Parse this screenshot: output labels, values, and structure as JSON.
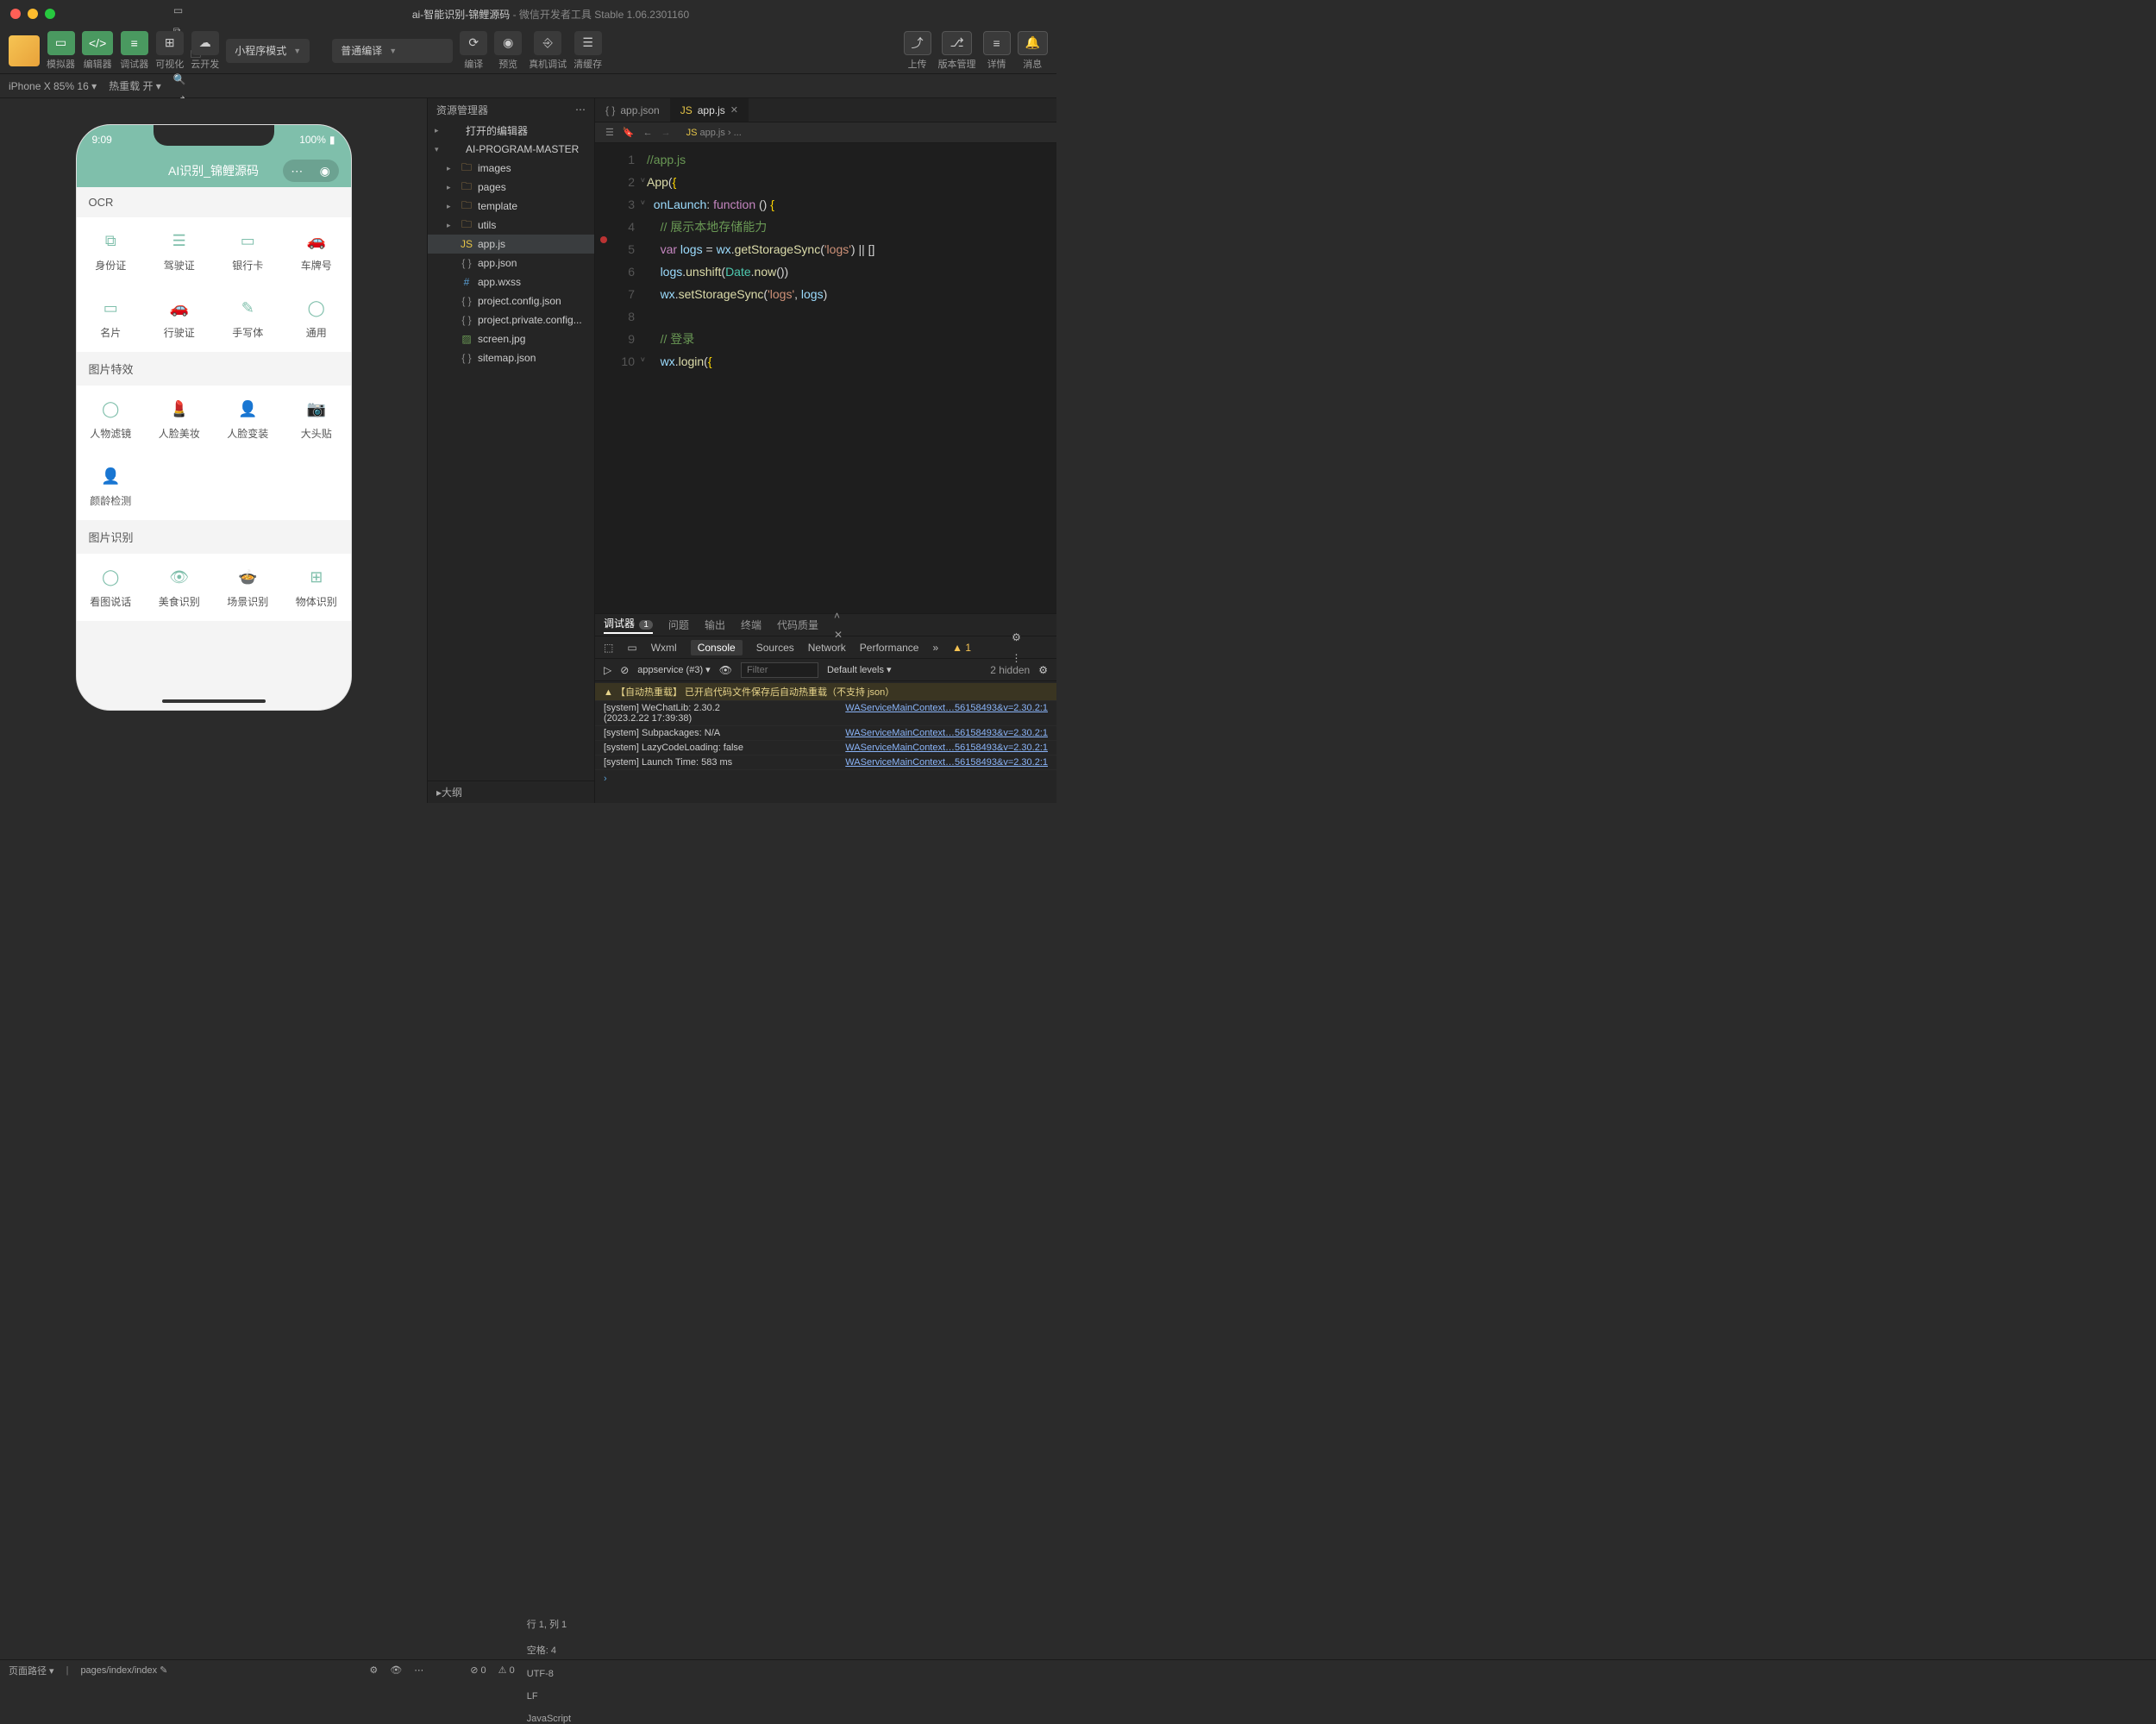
{
  "titlebar": {
    "project": "ai-智能识别-锦鲤源码",
    "app": "微信开发者工具 Stable 1.06.2301160"
  },
  "toolbar": {
    "simulator": "模拟器",
    "editor": "编辑器",
    "debugger": "调试器",
    "visual": "可视化",
    "cloud": "云开发",
    "mode": "小程序模式",
    "compile": "普通编译",
    "compile_btn": "编译",
    "preview": "预览",
    "remote": "真机调试",
    "clear": "清缓存",
    "upload": "上传",
    "version": "版本管理",
    "detail": "详情",
    "message": "消息"
  },
  "statusrow": {
    "device": "iPhone X 85% 16",
    "hotreload": "热重载 开"
  },
  "phone": {
    "time": "9:09",
    "battery": "100%",
    "title": "AI识别_锦鲤源码",
    "sections": [
      {
        "header": "OCR",
        "items": [
          "身份证",
          "驾驶证",
          "银行卡",
          "车牌号",
          "名片",
          "行驶证",
          "手写体",
          "通用"
        ]
      },
      {
        "header": "图片特效",
        "items": [
          "人物滤镜",
          "人脸美妆",
          "人脸变装",
          "大头贴",
          "颜龄检测"
        ]
      },
      {
        "header": "图片识别",
        "items": [
          "看图说话",
          "美食识别",
          "场景识别",
          "物体识别"
        ]
      }
    ]
  },
  "explorer": {
    "title": "资源管理器",
    "open_editors": "打开的编辑器",
    "root": "AI-PROGRAM-MASTER",
    "folders": [
      "images",
      "pages",
      "template",
      "utils"
    ],
    "files": [
      {
        "name": "app.js",
        "type": "js",
        "sel": true
      },
      {
        "name": "app.json",
        "type": "json"
      },
      {
        "name": "app.wxss",
        "type": "wxss"
      },
      {
        "name": "project.config.json",
        "type": "json"
      },
      {
        "name": "project.private.config...",
        "type": "json"
      },
      {
        "name": "screen.jpg",
        "type": "img"
      },
      {
        "name": "sitemap.json",
        "type": "json"
      }
    ],
    "outline": "大纲"
  },
  "editor": {
    "tabs": [
      {
        "name": "app.json",
        "icon": "json",
        "active": false
      },
      {
        "name": "app.js",
        "icon": "js",
        "active": true
      }
    ],
    "breadcrumb": "app.js › ...",
    "lines": [
      {
        "n": 1,
        "html": "<span class='c-comment'>//app.js</span>"
      },
      {
        "n": 2,
        "fold": "down",
        "html": "<span class='c-call'>App</span><span class='c-pun'>(</span><span class='c-brace'>{</span>"
      },
      {
        "n": 3,
        "fold": "down",
        "html": "  <span class='c-var'>onLaunch</span><span class='c-pun'>: </span><span class='c-kw'>function</span> <span class='c-pun'>() </span><span class='c-brace'>{</span>"
      },
      {
        "n": 4,
        "html": "    <span class='c-comment'>// 展示本地存储能力</span>"
      },
      {
        "n": 5,
        "bp": true,
        "html": "    <span class='c-kw'>var</span> <span class='c-var'>logs</span> <span class='c-pun'>=</span> <span class='c-var'>wx</span><span class='c-pun'>.</span><span class='c-call'>getStorageSync</span><span class='c-pun'>(</span><span class='c-str'>'logs'</span><span class='c-pun'>)</span> <span class='c-pun'>||</span> <span class='c-pun'>[]</span>"
      },
      {
        "n": 6,
        "html": "    <span class='c-var'>logs</span><span class='c-pun'>.</span><span class='c-call'>unshift</span><span class='c-pun'>(</span><span class='c-obj'>Date</span><span class='c-pun'>.</span><span class='c-call'>now</span><span class='c-pun'>())</span>"
      },
      {
        "n": 7,
        "html": "    <span class='c-var'>wx</span><span class='c-pun'>.</span><span class='c-call'>setStorageSync</span><span class='c-pun'>(</span><span class='c-str'>'logs'</span><span class='c-pun'>,</span> <span class='c-var'>logs</span><span class='c-pun'>)</span>"
      },
      {
        "n": 8,
        "html": ""
      },
      {
        "n": 9,
        "html": "    <span class='c-comment'>// 登录</span>"
      },
      {
        "n": 10,
        "fold": "down",
        "html": "    <span class='c-var'>wx</span><span class='c-pun'>.</span><span class='c-call'>login</span><span class='c-pun'>(</span><span class='c-brace'>{</span>"
      }
    ]
  },
  "debug": {
    "tabs": {
      "main": "调试器",
      "badge": "1",
      "problems": "问题",
      "output": "输出",
      "terminal": "终端",
      "quality": "代码质量"
    },
    "sub": [
      "Wxml",
      "Console",
      "Sources",
      "Network",
      "Performance"
    ],
    "sub_active": "Console",
    "warn_badge": "1",
    "context": "appservice (#3)",
    "filter_placeholder": "Filter",
    "levels": "Default levels",
    "hidden": "2 hidden",
    "messages": [
      {
        "type": "warn",
        "text": "【自动热重载】 已开启代码文件保存后自动热重载（不支持 json）"
      },
      {
        "type": "log",
        "text": "[system] WeChatLib: 2.30.2\n(2023.2.22 17:39:38)",
        "src": "WAServiceMainContext…56158493&v=2.30.2:1"
      },
      {
        "type": "log",
        "text": "[system] Subpackages: N/A",
        "src": "WAServiceMainContext…56158493&v=2.30.2:1"
      },
      {
        "type": "log",
        "text": "[system] LazyCodeLoading: false",
        "src": "WAServiceMainContext…56158493&v=2.30.2:1"
      },
      {
        "type": "log",
        "text": "[system] Launch Time: 583 ms",
        "src": "WAServiceMainContext…56158493&v=2.30.2:1"
      }
    ],
    "prompt": "›"
  },
  "statusbar": {
    "path_label": "页面路径",
    "path": "pages/index/index",
    "errors": "0",
    "warns": "0",
    "ln": "行 1, 列 1",
    "spaces": "空格: 4",
    "enc": "UTF-8",
    "eol": "LF",
    "lang": "JavaScript"
  }
}
